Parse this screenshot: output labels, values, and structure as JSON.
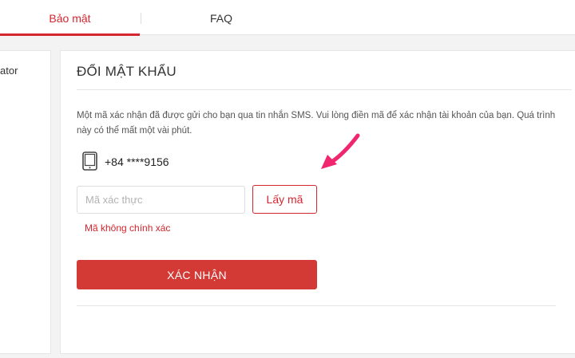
{
  "tabs": {
    "security_label": "Bảo mật",
    "faq_label": "FAQ"
  },
  "sidebar": {
    "partial_text": "ator"
  },
  "change_password": {
    "title": "ĐỔI MẬT KHẨU",
    "description": "Một mã xác nhận đã được gửi cho bạn qua tin nhắn SMS. Vui lòng điền mã để xác nhận tài khoản của bạn. Quá trình này có thể mất một vài phút.",
    "phone_icon": "mobile-phone-icon",
    "phone_number": "+84 ****9156",
    "code_input": {
      "placeholder": "Mã xác thực",
      "value": ""
    },
    "get_code_label": "Lấy mã",
    "error_message": "Mã không chính xác",
    "confirm_label": "XÁC NHẬN"
  },
  "annotation": {
    "arrow_icon": "pointer-arrow-icon",
    "color": "#f0266e"
  },
  "colors": {
    "accent": "#d5252e",
    "confirm_button": "#d43a35",
    "background": "#f3f3f3"
  }
}
